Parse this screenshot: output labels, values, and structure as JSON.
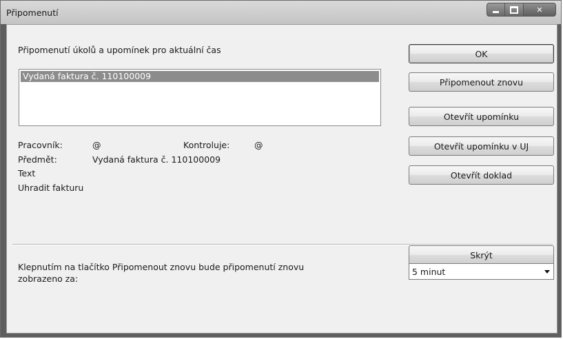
{
  "window": {
    "title": "Připomenutí"
  },
  "header": {
    "caption": "Připomenutí úkolů a upomínek pro aktuální čas"
  },
  "list": {
    "items": [
      "Vydaná faktura č. 110100009"
    ]
  },
  "details": {
    "worker_label": "Pracovník:",
    "worker_value": "@",
    "checks_label": "Kontroluje:",
    "checks_value": "@",
    "subject_label": "Předmět:",
    "subject_value": "Vydaná faktura č. 110100009",
    "text_label": "Text",
    "text_value": "Uhradit fakturu"
  },
  "buttons": {
    "ok": "OK",
    "remind_again": "Připomenout znovu",
    "open_reminder": "Otevřít upomínku",
    "open_reminder_uj": "Otevřít upomínku v UJ",
    "open_document": "Otevřít doklad",
    "hide": "Skrýt"
  },
  "footer": {
    "note": "Klepnutím na tlačítko Připomenout znovu bude připomenutí znovu zobrazeno za:",
    "interval_selected": "5 minut"
  }
}
